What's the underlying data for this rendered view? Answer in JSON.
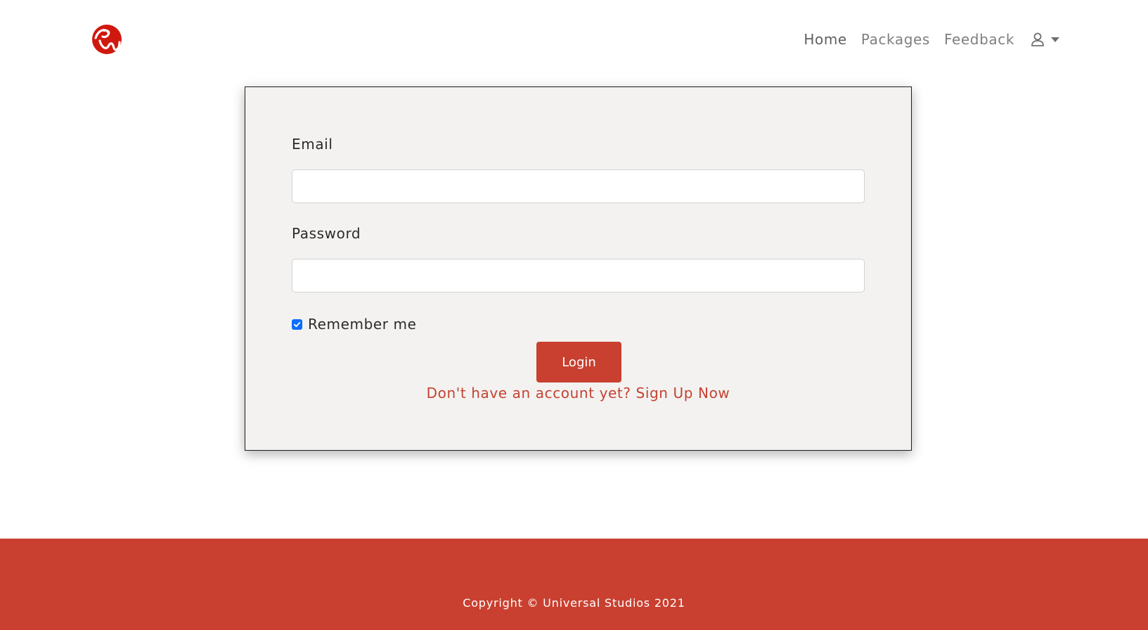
{
  "navbar": {
    "logo_icon": "rws-logo-icon",
    "links": [
      {
        "label": "Home"
      },
      {
        "label": "Packages"
      },
      {
        "label": "Feedback"
      }
    ],
    "user_menu_icon": "user-icon"
  },
  "login_form": {
    "email_label": "Email",
    "email_value": "",
    "password_label": "Password",
    "password_value": "",
    "remember_label": "Remember me",
    "remember_checked": true,
    "login_label": "Login",
    "signup_text": "Don't have an account yet? Sign Up Now"
  },
  "footer": {
    "copyright": "Copyright © Universal Studios 2021"
  },
  "colors": {
    "accent": "#c94030",
    "card_bg": "#f3f2f0",
    "checkbox": "#0b6efd",
    "nav_text": "#7f7f7f"
  }
}
